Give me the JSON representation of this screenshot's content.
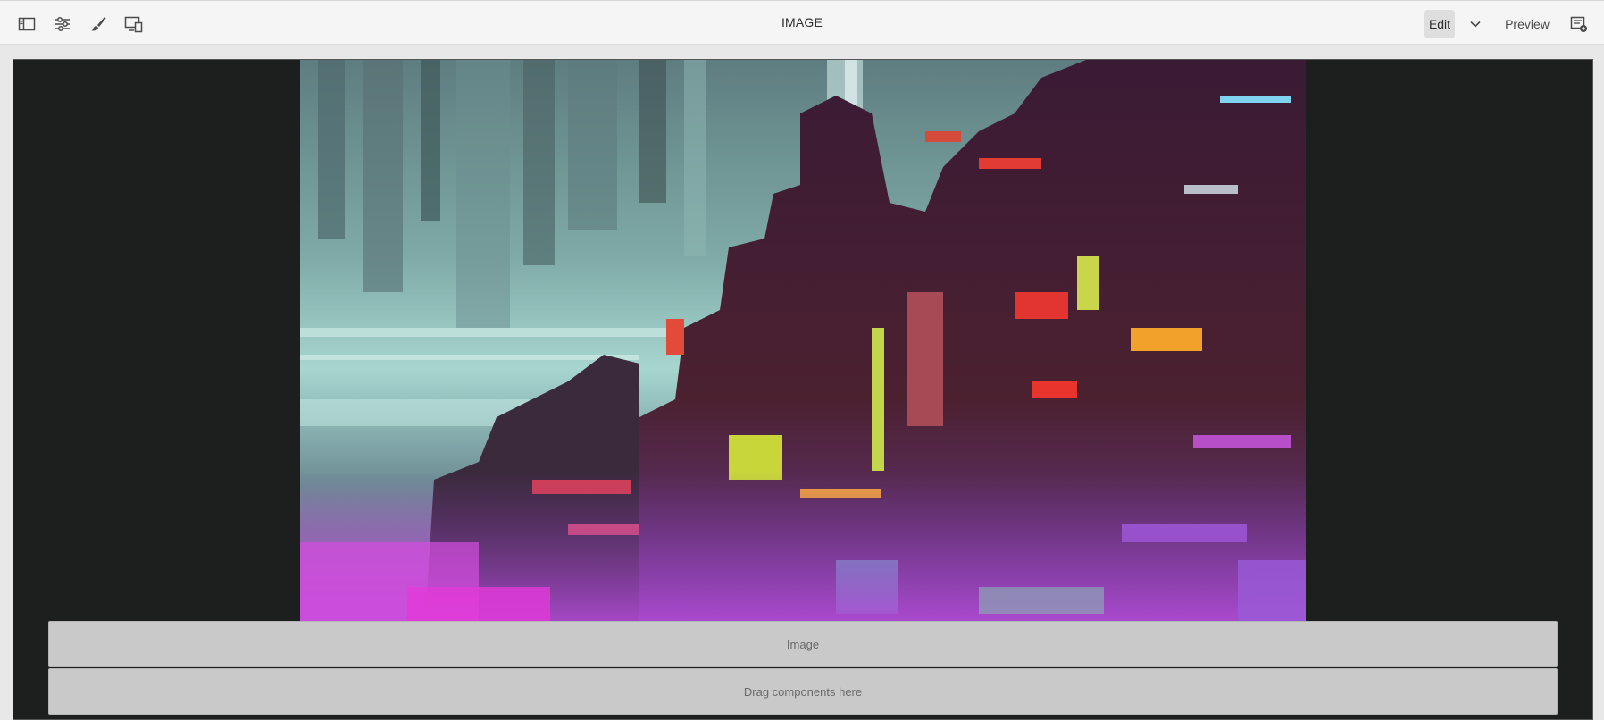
{
  "toolbar": {
    "title": "IMAGE",
    "left_icons": [
      "side-panel-icon",
      "properties-icon",
      "style-brush-icon",
      "emulator-icon"
    ],
    "edit_label": "Edit",
    "preview_label": "Preview",
    "mode_menu_icon": "chevron-down-icon",
    "right_icon": "annotate-icon"
  },
  "canvas": {
    "image_component_label": "Image",
    "drop_zone_label": "Drag components here"
  },
  "colors": {
    "toolbar_bg": "#f5f5f5",
    "stage_bg": "#1c1f1e",
    "placeholder_bg": "#c9c9c9",
    "active_button_bg": "#dedede"
  }
}
